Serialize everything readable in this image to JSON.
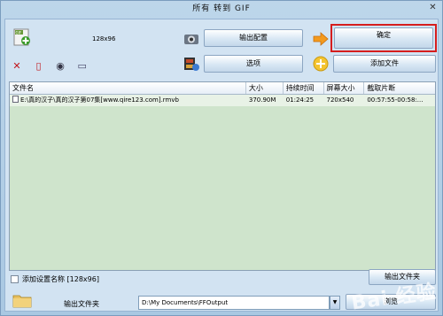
{
  "window": {
    "title": "所有 转到 GIF",
    "close_glyph": "✕"
  },
  "profile": {
    "resolution": "128x96"
  },
  "toolbar": {
    "output_config_label": "输出配置",
    "ok_label": "确定",
    "options_label": "选项",
    "add_file_label": "添加文件"
  },
  "list": {
    "columns": [
      "文件名",
      "大小",
      "持续时间",
      "屏幕大小",
      "截取片断"
    ],
    "rows": [
      {
        "filename": "E:\\真的汉子\\真的汉子第07集[www.qire123.com].rmvb",
        "size": "370.90M",
        "duration": "01:24:25",
        "screen": "720x540",
        "clip": "00:57:55-00:58:..."
      }
    ]
  },
  "bottom": {
    "add_setting_name_label": "添加设置名称 [128x96]",
    "output_folder_label": "输出文件夹",
    "output_path": "D:\\My Documents\\FFOutput",
    "browse_label": "浏览",
    "partial_button_label": "输出文件夹"
  },
  "watermark": "Bai 经验",
  "colors": {
    "highlight": "#d61d1d",
    "list_bg": "#cfe4cc",
    "panel_bg": "#d2e3f2"
  }
}
